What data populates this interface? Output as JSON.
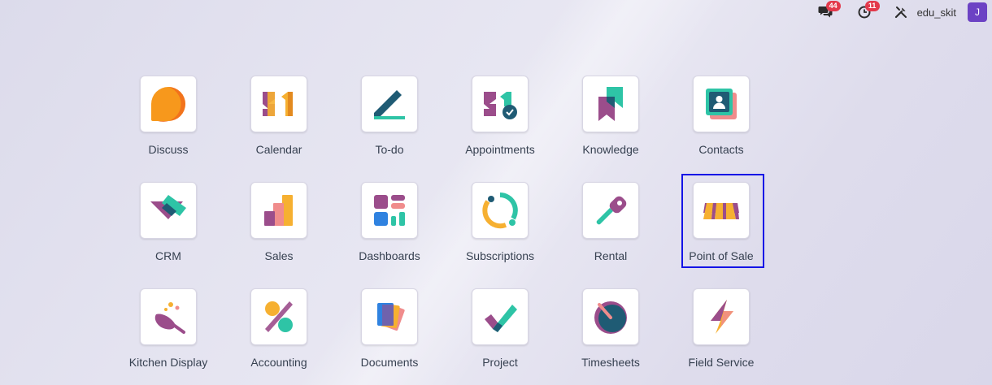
{
  "topbar": {
    "chat_count": "44",
    "activity_count": "11",
    "user_name": "edu_skit",
    "avatar_initial": "J"
  },
  "apps": [
    {
      "label": "Discuss",
      "icon": "discuss-icon"
    },
    {
      "label": "Calendar",
      "icon": "calendar-icon"
    },
    {
      "label": "To-do",
      "icon": "todo-icon"
    },
    {
      "label": "Appointments",
      "icon": "appointments-icon"
    },
    {
      "label": "Knowledge",
      "icon": "knowledge-icon"
    },
    {
      "label": "Contacts",
      "icon": "contacts-icon"
    },
    {
      "label": "CRM",
      "icon": "crm-icon"
    },
    {
      "label": "Sales",
      "icon": "sales-icon"
    },
    {
      "label": "Dashboards",
      "icon": "dashboards-icon"
    },
    {
      "label": "Subscriptions",
      "icon": "subscriptions-icon"
    },
    {
      "label": "Rental",
      "icon": "rental-icon"
    },
    {
      "label": "Point of Sale",
      "icon": "point-of-sale-icon"
    },
    {
      "label": "Kitchen Display",
      "icon": "kitchen-display-icon"
    },
    {
      "label": "Accounting",
      "icon": "accounting-icon"
    },
    {
      "label": "Documents",
      "icon": "documents-icon"
    },
    {
      "label": "Project",
      "icon": "project-icon"
    },
    {
      "label": "Timesheets",
      "icon": "timesheets-icon"
    },
    {
      "label": "Field Service",
      "icon": "field-service-icon"
    }
  ],
  "selected_app": "Point of Sale",
  "colors": {
    "selection_border": "#1414e6",
    "avatar": "#6c42c4",
    "badge": "#e3394b"
  }
}
